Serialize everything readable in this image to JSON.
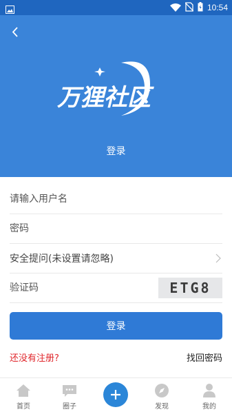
{
  "statusbar": {
    "time": "10:54"
  },
  "header": {
    "brand_name": "万狸社区",
    "subtitle": "登录"
  },
  "form": {
    "username_placeholder": "请输入用户名",
    "password_placeholder": "密码",
    "security_question": "安全提问(未设置请忽略)",
    "captcha_placeholder": "验证码",
    "captcha_text": "ETG8"
  },
  "actions": {
    "login_label": "登录",
    "register_label": "还没有注册?",
    "forgot_label": "找回密码"
  },
  "tabbar": {
    "items": [
      {
        "label": "首页",
        "icon": "home-icon"
      },
      {
        "label": "圈子",
        "icon": "chat-icon"
      },
      {
        "label": "",
        "icon": "plus-icon"
      },
      {
        "label": "发现",
        "icon": "compass-icon"
      },
      {
        "label": "我的",
        "icon": "person-icon"
      }
    ]
  },
  "colors": {
    "header_bg": "#3a84d9",
    "statusbar_bg": "#1f66bf",
    "primary_button": "#2f7ad6",
    "register_link": "#e0262b"
  }
}
